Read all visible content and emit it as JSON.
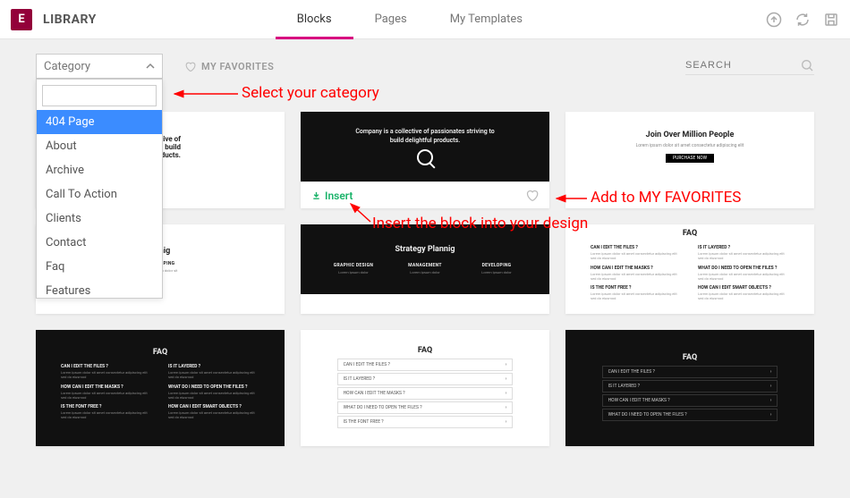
{
  "header": {
    "title": "LIBRARY",
    "tabs": [
      "Blocks",
      "Pages",
      "My Templates"
    ],
    "active_tab": 0
  },
  "toolbar": {
    "category_label": "Category",
    "favorites_label": "MY FAVORITES",
    "search_placeholder": "SEARCH"
  },
  "dropdown": {
    "items": [
      "404 Page",
      "About",
      "Archive",
      "Call To Action",
      "Clients",
      "Contact",
      "Faq",
      "Features"
    ],
    "selected_index": 0
  },
  "annotations": {
    "select_category": "Select your category",
    "add_favorites": "Add to MY FAVORITES",
    "insert_block": "Insert the block into your design"
  },
  "cards": {
    "insert_label": "Insert",
    "c1": {
      "title_part": "llective of\ning to build\nducts."
    },
    "c2": {
      "title": "Company is a collective of passionates striving to build delightful products."
    },
    "c3": {
      "title": "Join Over Million People",
      "button": "PURCHASE NOW"
    },
    "c4": {
      "title": "annig",
      "col": "DEVELOPING"
    },
    "c5": {
      "title": "Strategy Plannig",
      "cols": [
        "GRAPHIC DESIGN",
        "MANAGEMENT",
        "DEVELOPING"
      ]
    },
    "faq": {
      "title": "FAQ",
      "q1": "CAN I EDIT THE FILES ?",
      "q2": "IS IT LAYERED ?",
      "q3": "HOW CAN I EDIT THE MASKS ?",
      "q4": "WHAT DO I NEED TO OPEN THE FILES ?",
      "q5": "IS THE FONT FREE ?",
      "q6": "HOW CAN I EDIT SMART OBJECTS ?",
      "a": "Lorem ipsum dolor sit amet consectetur adipiscing elit sed do eiusmod"
    }
  }
}
